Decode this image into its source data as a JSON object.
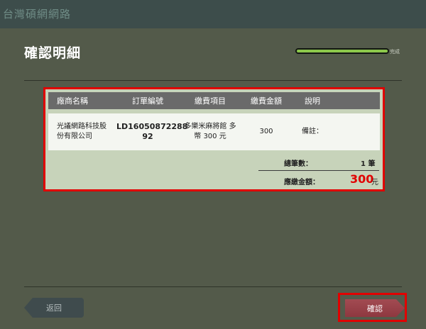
{
  "app": {
    "title": "台灣碩網網路"
  },
  "page": {
    "title": "確認明細"
  },
  "progress": {
    "value_percent": 100,
    "label": "完成",
    "fill_color": "#8cc84b"
  },
  "table": {
    "headers": [
      "廠商名稱",
      "訂單編號",
      "繳費項目",
      "繳費金額",
      "說明"
    ],
    "rows": [
      {
        "vendor_line1": "光議網路科技股",
        "vendor_line2": "份有限公司",
        "order_line1": "LD16050872288",
        "order_line2": "92",
        "item_line1": "多樂米麻將館 多",
        "item_line2": "幣 300 元",
        "amount": "300",
        "note": "備註："
      }
    ]
  },
  "summary": {
    "count_label": "總筆數：",
    "count_value": "1 筆",
    "total_label": "應繳金額：",
    "total_value": "300",
    "total_unit": "元"
  },
  "buttons": {
    "back": "返回",
    "confirm": "確認"
  },
  "colors": {
    "background": "#535a4a",
    "highlight": "#e10000",
    "confirm": "#9a434b",
    "total": "#e10000"
  }
}
